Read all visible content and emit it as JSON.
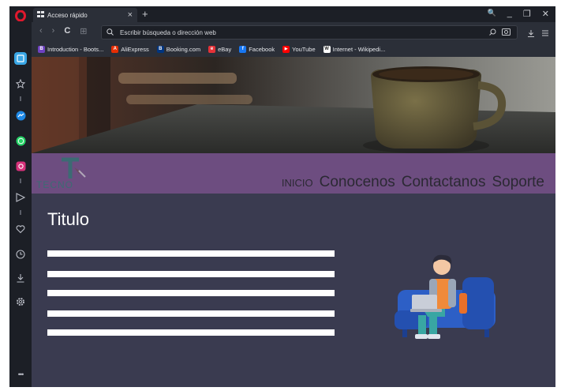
{
  "browser": {
    "tab": {
      "title": "Acceso rápido",
      "close": "×",
      "new_tab": "+"
    },
    "window_controls": [
      "🔍",
      "_",
      "❐",
      "✕"
    ],
    "address_bar": {
      "placeholder": "Escribir búsqueda o dirección web"
    },
    "nav_buttons": [
      "‹",
      "›",
      "C",
      "⊞"
    ],
    "bookmarks": [
      {
        "label": "Introduction - Boots...",
        "icon": "bootstrap-icon",
        "color": "#6f42c1",
        "glyph": "B"
      },
      {
        "label": "AliExpress",
        "icon": "aliexpress-icon",
        "color": "#e62e04",
        "glyph": "A"
      },
      {
        "label": "Booking.com",
        "icon": "booking-icon",
        "color": "#003580",
        "glyph": "B"
      },
      {
        "label": "eBay",
        "icon": "ebay-icon",
        "color": "#e53238",
        "glyph": "e"
      },
      {
        "label": "Facebook",
        "icon": "facebook-icon",
        "color": "#1877f2",
        "glyph": "f"
      },
      {
        "label": "YouTube",
        "icon": "youtube-icon",
        "color": "#ff0000",
        "glyph": "▶"
      },
      {
        "label": "Internet - Wikipedi...",
        "icon": "wikipedia-icon",
        "color": "#ffffff",
        "glyph": "W"
      }
    ],
    "sidebar_icons": [
      "speed-dial-icon",
      "star-icon",
      "messenger-icon",
      "whatsapp-icon",
      "instagram-icon",
      "send-icon",
      "heart-icon",
      "clock-icon",
      "download-icon",
      "settings-icon"
    ],
    "sidebar_more": "•••"
  },
  "site": {
    "logo_text": "TECNO",
    "nav": {
      "home": "INICIO",
      "about": "Conocenos",
      "contact": "Contactanos",
      "support": "Soporte"
    },
    "title": "Titulo",
    "placeholder_lines": 5
  },
  "colors": {
    "navbar": "#6d4d80",
    "content_bg": "#3a3b50",
    "chrome_bg": "#1c1f26"
  }
}
